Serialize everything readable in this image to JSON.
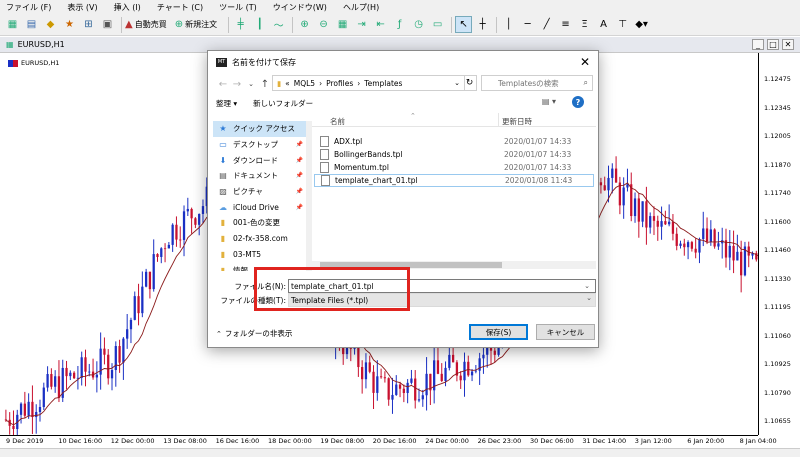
{
  "menu": [
    "ファイル (F)",
    "表示 (V)",
    "挿入 (I)",
    "チャート (C)",
    "ツール (T)",
    "ウインドウ(W)",
    "ヘルプ(H)"
  ],
  "toolbar": {
    "auto_trade": "自動売買",
    "new_order": "新規注文"
  },
  "chart_window": {
    "tab_title": "EURUSD,H1",
    "symbol_label": "EURUSD,H1"
  },
  "dialog": {
    "title": "名前を付けて保存",
    "path": [
      "MQL5",
      "Profiles",
      "Templates"
    ],
    "search_placeholder": "Templatesの検索",
    "organize": "整理",
    "new_folder": "新しいフォルダー",
    "nav_items": [
      {
        "label": "クイック アクセス",
        "icon": "star-icon",
        "pinned": false
      },
      {
        "label": "デスクトップ",
        "icon": "desktop-icon",
        "pinned": true
      },
      {
        "label": "ダウンロード",
        "icon": "download-icon",
        "pinned": true
      },
      {
        "label": "ドキュメント",
        "icon": "document-icon",
        "pinned": true
      },
      {
        "label": "ピクチャ",
        "icon": "picture-icon",
        "pinned": true
      },
      {
        "label": "iCloud Drive",
        "icon": "cloud-icon",
        "pinned": true
      },
      {
        "label": "001-色の変更",
        "icon": "folder-icon",
        "pinned": false
      },
      {
        "label": "02-fx-358.com",
        "icon": "folder-icon",
        "pinned": false
      },
      {
        "label": "03-MT5",
        "icon": "folder-icon",
        "pinned": false
      },
      {
        "label": "情報",
        "icon": "folder-icon",
        "pinned": false
      }
    ],
    "columns": {
      "name": "名前",
      "date": "更新日時"
    },
    "files": [
      {
        "name": "ADX.tpl",
        "date": "2020/01/07 14:33"
      },
      {
        "name": "BollingerBands.tpl",
        "date": "2020/01/07 14:33"
      },
      {
        "name": "Momentum.tpl",
        "date": "2020/01/07 14:33"
      },
      {
        "name": "template_chart_01.tpl",
        "date": "2020/01/08 11:43"
      }
    ],
    "filename_label": "ファイル名(N):",
    "filename_value": "template_chart_01.tpl",
    "filetype_label": "ファイルの種類(T):",
    "filetype_value": "Template Files (*.tpl)",
    "hide_folders": "フォルダーの非表示",
    "save_button": "保存(S)",
    "cancel_button": "キャンセル"
  },
  "price_axis": [
    "1.12475",
    "1.12345",
    "1.12005",
    "1.11870",
    "1.11740",
    "1.11600",
    "1.11460",
    "1.11330",
    "1.11195",
    "1.11060",
    "1.10925",
    "1.10790",
    "1.10655"
  ],
  "time_axis": [
    "9 Dec 2019",
    "10 Dec 16:00",
    "12 Dec 00:00",
    "13 Dec 08:00",
    "16 Dec 16:00",
    "18 Dec 00:00",
    "19 Dec 08:00",
    "20 Dec 16:00",
    "24 Dec 00:00",
    "26 Dec 23:00",
    "30 Dec 06:00",
    "31 Dec 14:00",
    "3 Jan 12:00",
    "6 Jan 20:00",
    "8 Jan 04:00"
  ],
  "colors": {
    "bull": "#1a30c4",
    "bear": "#c8102e",
    "ma": "#8b1a1a",
    "highlight": "#e0241f"
  },
  "chart_data": {
    "type": "line",
    "title": "EURUSD,H1",
    "xlabel": "",
    "ylabel": "",
    "ylim": [
      1.1058,
      1.1255
    ],
    "x": [
      "9 Dec 2019",
      "10 Dec 16:00",
      "12 Dec 00:00",
      "13 Dec 08:00",
      "16 Dec 16:00",
      "18 Dec 00:00",
      "19 Dec 08:00",
      "20 Dec 16:00",
      "24 Dec 00:00",
      "26 Dec 23:00",
      "30 Dec 06:00",
      "31 Dec 14:00",
      "3 Jan 12:00",
      "6 Jan 20:00",
      "8 Jan 04:00"
    ],
    "series": [
      {
        "values": [
          1.1066,
          1.1085,
          1.1097,
          1.1162,
          1.1185,
          1.1135,
          1.1115,
          1.108,
          1.1088,
          1.1102,
          1.1125,
          1.1195,
          1.1165,
          1.1158,
          1.1142
        ]
      }
    ]
  }
}
